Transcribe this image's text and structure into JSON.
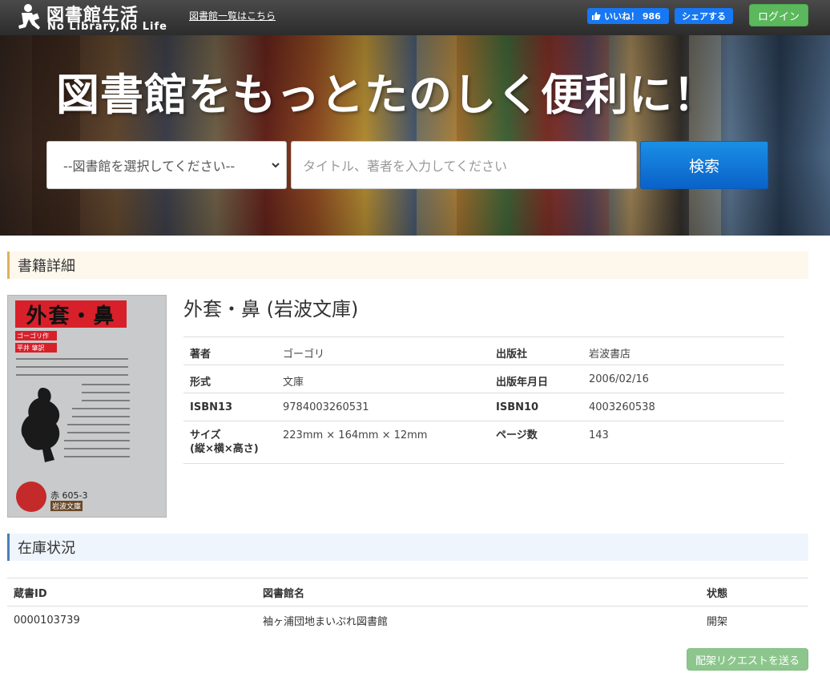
{
  "header": {
    "brand_title": "図書館生活",
    "brand_subtitle": "No Library,No Life",
    "library_list_link": "図書館一覧はこちら",
    "like_label": "いいね！ 986",
    "share_label": "シェアする",
    "login_label": "ログイン"
  },
  "hero": {
    "headline": "図書館をもっとたのしく便利に！",
    "library_select_value": "--図書館を選択してください--",
    "search_placeholder": "タイトル、著者を入力してください",
    "search_button": "検索"
  },
  "book_section": {
    "heading": "書籍詳細",
    "title": "外套・鼻 (岩波文庫)",
    "cover": {
      "title": "外套・鼻",
      "author_tag": "ゴーゴリ作",
      "translator_tag": "平井 肇訳",
      "number": "赤 605-3",
      "imprint": "岩波文庫"
    },
    "details": {
      "author_label": "著者",
      "author_value": "ゴーゴリ",
      "publisher_label": "出版社",
      "publisher_value": "岩波書店",
      "format_label": "形式",
      "format_value": "文庫",
      "pubdate_label": "出版年月日",
      "pubdate_value": "2006/02/16",
      "isbn13_label": "ISBN13",
      "isbn13_value": "9784003260531",
      "isbn10_label": "ISBN10",
      "isbn10_value": "4003260538",
      "size_label_1": "サイズ",
      "size_label_2": "(縦×横×高さ)",
      "size_value": "223mm × 164mm × 12mm",
      "pages_label": "ページ数",
      "pages_value": "143"
    }
  },
  "stock_section": {
    "heading": "在庫状況",
    "columns": [
      "蔵書ID",
      "図書館名",
      "状態"
    ],
    "rows": [
      [
        "0000103739",
        "袖ヶ浦団地まいぷれ図書館",
        "開架"
      ]
    ],
    "request_button": "配架リクエストを送る"
  },
  "colors": {
    "navbar": "#333333",
    "login_green": "#5cb85c",
    "facebook_blue": "#1877f2",
    "search_blue": "#0a62c8",
    "book_header_accent": "#e0b15e",
    "stock_header_accent": "#4a7fb5"
  }
}
